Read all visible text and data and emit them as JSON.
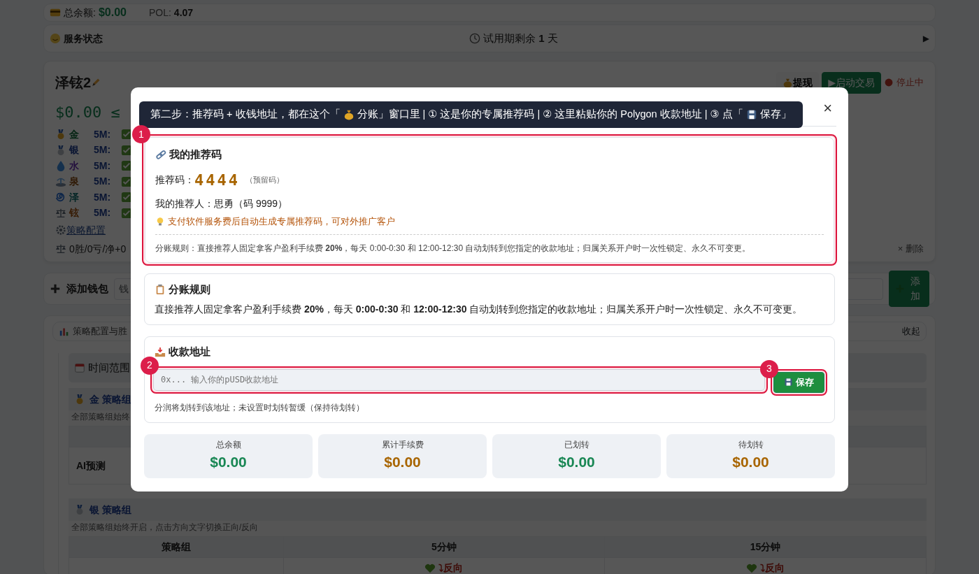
{
  "top_bar": {
    "balance_label": "总余额:",
    "balance": "$0.00",
    "pol_label": "POL:",
    "pol": "4.07"
  },
  "service": {
    "title": "服务状态",
    "trial": "试用期剩余 **1** 天",
    "toggle": "▶"
  },
  "wallet": {
    "name": "泽铉2",
    "amount": "$0.00 ≤",
    "withdraw": "提现",
    "start": "▶启动交易",
    "state": "停止中",
    "strategies": [
      {
        "name": "金",
        "interval": "5M:"
      },
      {
        "name": "银",
        "interval": "5M:"
      },
      {
        "name": "水",
        "interval": "5M:"
      },
      {
        "name": "泉",
        "interval": "5M:"
      },
      {
        "name": "泽",
        "interval": "5M:"
      },
      {
        "name": "铉",
        "interval": "5M:"
      }
    ],
    "config_link": "策略配置",
    "record": "0胜/0亏/净+0",
    "delete": "× 删除"
  },
  "add_wallet": {
    "title": "添加钱包",
    "placeholder": "钱",
    "button": "添加"
  },
  "strategy_panel": {
    "tab": "策略配置与胜",
    "collapse": "收起",
    "time_range": "时间范围",
    "groups": [
      {
        "title": "金 策略组",
        "note": "全部策略组始终",
        "rows": [
          {
            "label": "AI预测"
          }
        ]
      },
      {
        "title": "银 策略组",
        "note": "全部策略组始终开启，点击方向文字切换正向/反向",
        "columns": [
          "策略组",
          "5分钟",
          "15分钟"
        ],
        "rows": [
          {
            "cells": [
              "",
              "⤵反向",
              "⤵反向"
            ]
          }
        ]
      }
    ]
  },
  "modal": {
    "close": "×",
    "tour": {
      "before": "第二步：推荐码 + 收钱地址，都在这个「",
      "middle": "分账」窗口里 | ① 这是你的专属推荐码 | ② 这里粘贴你的 Polygon 收款地址 | ③ 点「",
      "after": "保存」"
    },
    "referral": {
      "step": "1",
      "title": "我的推荐码",
      "code_label": "推荐码：",
      "code": "4444",
      "code_note": "（预留码）",
      "referrer": "我的推荐人：思勇（码 9999）",
      "tip": "支付软件服务费后自动生成专属推荐码，可对外推广客户",
      "rule": "分账规则：直接推荐人固定拿客户盈利手续费 **20%**，每天 0:00-0:30 和 12:00-12:30 自动划转到您指定的收款地址；归属关系开户时一次性锁定、永久不可变更。"
    },
    "rules": {
      "title": "分账规则",
      "text": "直接推荐人固定拿客户盈利手续费 **20%**，每天 **0:00-0:30** 和 **12:00-12:30** 自动划转到您指定的收款地址；归属关系开户时一次性锁定、永久不可变更。"
    },
    "address": {
      "title": "收款地址",
      "field_step": "2",
      "placeholder": "0x... 输入你的pUSD收款地址",
      "button_step": "3",
      "button": "保存",
      "note": "分润将划转到该地址；未设置时划转暂缓（保持待划转）"
    },
    "stats": [
      {
        "label": "总余额",
        "value": "$0.00",
        "color": "#198754"
      },
      {
        "label": "累计手续费",
        "value": "$0.00",
        "color": "#a86500"
      },
      {
        "label": "已划转",
        "value": "$0.00",
        "color": "#198754"
      },
      {
        "label": "待划转",
        "value": "$0.00",
        "color": "#a86500"
      }
    ]
  }
}
